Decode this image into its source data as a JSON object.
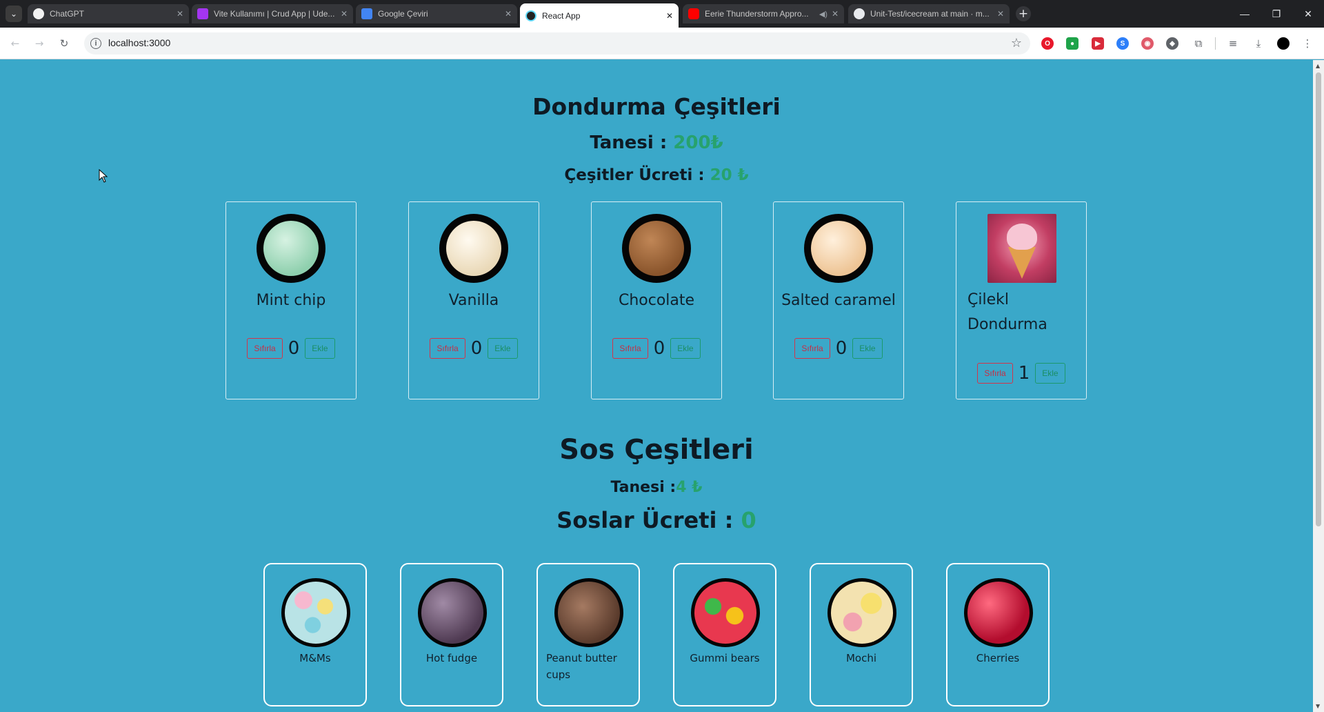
{
  "browser": {
    "tabs": [
      {
        "title": "ChatGPT",
        "active": false
      },
      {
        "title": "Vite Kullanımı | Crud App | Ude...",
        "active": false
      },
      {
        "title": "Google Çeviri",
        "active": false
      },
      {
        "title": "React App",
        "active": true
      },
      {
        "title": "Eerie Thunderstorm Appro...",
        "active": false
      },
      {
        "title": "Unit-Test/icecream at main · m...",
        "active": false
      }
    ],
    "url": "localhost:3000"
  },
  "icecream": {
    "title": "Dondurma Çeşitleri",
    "price_label": "Tanesi : ",
    "price_value": "200₺",
    "total_label": "Çeşitler Ücreti : ",
    "total_value": "20 ₺",
    "reset_label": "Sıfırla",
    "add_label": "Ekle",
    "items": [
      {
        "name": "Mint chip",
        "count": "0",
        "color": "#a6dcc0"
      },
      {
        "name": "Vanilla",
        "count": "0",
        "color": "#f3e7d0"
      },
      {
        "name": "Chocolate",
        "count": "0",
        "color": "#a0683c"
      },
      {
        "name": "Salted caramel",
        "count": "0",
        "color": "#f4d3aa"
      },
      {
        "name": "Çilekl Dondurma",
        "count": "1",
        "color": "#d94a72"
      }
    ]
  },
  "sauces": {
    "title": "Sos Çeşitleri",
    "price_label": "Tanesi :",
    "price_value": "4 ₺",
    "total_label": "Soslar Ücreti : ",
    "total_value": "0",
    "items": [
      {
        "name": "M&Ms",
        "color": "#9fd6d8"
      },
      {
        "name": "Hot fudge",
        "color": "#5e4660"
      },
      {
        "name": "Peanut butter cups",
        "color": "#6b4a3a"
      },
      {
        "name": "Gummi bears",
        "color": "#e8384f"
      },
      {
        "name": "Mochi",
        "color": "#f2d98a"
      },
      {
        "name": "Cherries",
        "color": "#c8102e"
      }
    ]
  }
}
